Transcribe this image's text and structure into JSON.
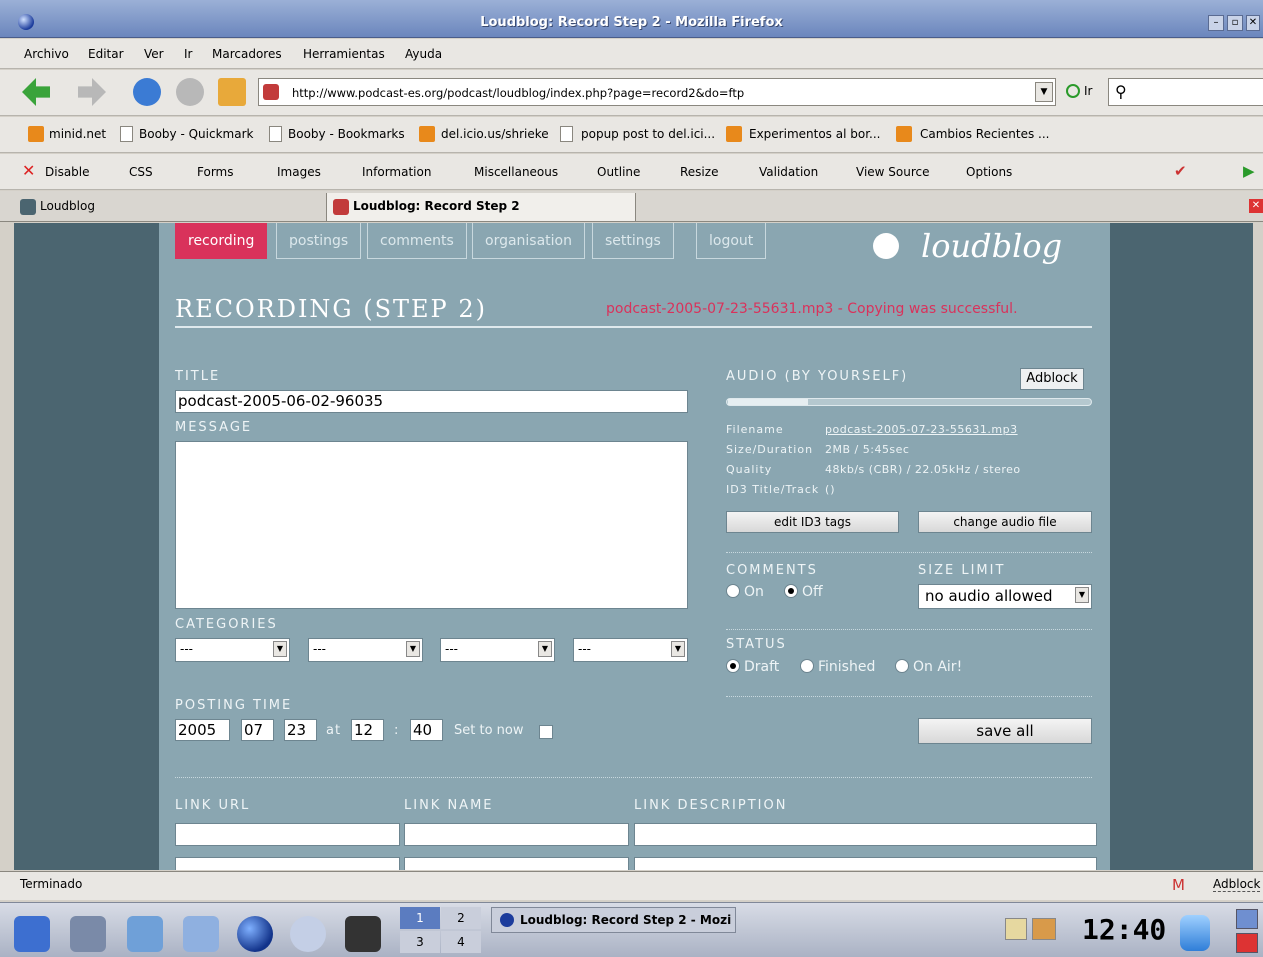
{
  "window": {
    "title": "Loudblog: Record Step 2 - Mozilla Firefox"
  },
  "menu": [
    "Archivo",
    "Editar",
    "Ver",
    "Ir",
    "Marcadores",
    "Herramientas",
    "Ayuda"
  ],
  "nav": {
    "url": "http://www.podcast-es.org/podcast/loudblog/index.php?page=record2&do=ftp",
    "go": "Ir"
  },
  "bookmarks": [
    "minid.net",
    "Booby - Quickmark",
    "Booby - Bookmarks",
    "del.icio.us/shrieke",
    "popup post to del.ici...",
    "Experimentos al bor...",
    "Cambios Recientes ..."
  ],
  "devbar": [
    "Disable",
    "CSS",
    "Forms",
    "Images",
    "Information",
    "Miscellaneous",
    "Outline",
    "Resize",
    "Validation",
    "View Source",
    "Options"
  ],
  "tabs": [
    "Loudblog",
    "Loudblog: Record Step 2"
  ],
  "page": {
    "nav": [
      "recording",
      "postings",
      "comments",
      "organisation",
      "settings",
      "logout"
    ],
    "logo": "loudblog",
    "heading": "RECORDING (STEP 2)",
    "status": "podcast-2005-07-23-55631.mp3 - Copying was successful.",
    "title_label": "TITLE",
    "title_value": "podcast-2005-06-02-96035",
    "message_label": "MESSAGE",
    "categories_label": "CATEGORIES",
    "categories": [
      "---",
      "---",
      "---",
      "---"
    ],
    "posting_time_label": "POSTING TIME",
    "posting_time": {
      "year": "2005",
      "month": "07",
      "day": "23",
      "at": "at",
      "hour": "12",
      "sep": ":",
      "minute": "40",
      "set_now": "Set to now"
    },
    "audio_label": "AUDIO (BY YOURSELF)",
    "adblock": "Adblock",
    "audio_info": [
      {
        "k": "Filename",
        "v": "podcast-2005-07-23-55631.mp3"
      },
      {
        "k": "Size/Duration",
        "v": "2MB / 5:45sec"
      },
      {
        "k": "Quality",
        "v": "48kb/s (CBR) / 22.05kHz / stereo"
      },
      {
        "k": "ID3 Title/Track",
        "v": "()"
      }
    ],
    "edit_id3": "edit ID3 tags",
    "change_audio": "change audio file",
    "comments_label": "COMMENTS",
    "comments_on": "On",
    "comments_off": "Off",
    "size_limit_label": "SIZE LIMIT",
    "size_limit_value": "no audio allowed",
    "status_label": "STATUS",
    "status_opts": [
      "Draft",
      "Finished",
      "On Air!"
    ],
    "save_all": "save all",
    "link_url": "LINK URL",
    "link_name": "LINK NAME",
    "link_desc": "LINK DESCRIPTION"
  },
  "statusbar": {
    "text": "Terminado",
    "adblock": "Adblock"
  },
  "taskbar": {
    "pager": [
      "1",
      "2",
      "3",
      "4"
    ],
    "task": "Loudblog: Record Step 2 - Mozi",
    "clock": "12:40"
  },
  "colors": {
    "accent": "#d9325b",
    "page_bg": "#8aa6b1",
    "outer_bg": "#4b6570"
  }
}
